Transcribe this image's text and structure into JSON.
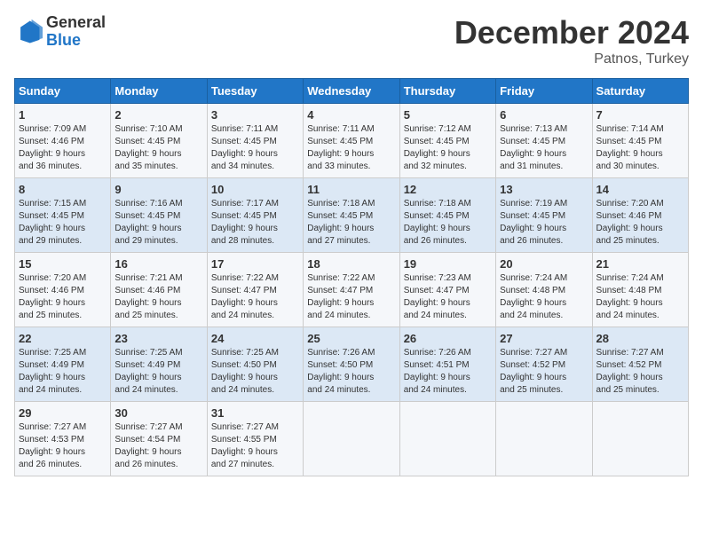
{
  "header": {
    "logo_general": "General",
    "logo_blue": "Blue",
    "month_title": "December 2024",
    "subtitle": "Patnos, Turkey"
  },
  "days_of_week": [
    "Sunday",
    "Monday",
    "Tuesday",
    "Wednesday",
    "Thursday",
    "Friday",
    "Saturday"
  ],
  "weeks": [
    [
      {
        "day": "1",
        "info": "Sunrise: 7:09 AM\nSunset: 4:46 PM\nDaylight: 9 hours\nand 36 minutes."
      },
      {
        "day": "2",
        "info": "Sunrise: 7:10 AM\nSunset: 4:45 PM\nDaylight: 9 hours\nand 35 minutes."
      },
      {
        "day": "3",
        "info": "Sunrise: 7:11 AM\nSunset: 4:45 PM\nDaylight: 9 hours\nand 34 minutes."
      },
      {
        "day": "4",
        "info": "Sunrise: 7:11 AM\nSunset: 4:45 PM\nDaylight: 9 hours\nand 33 minutes."
      },
      {
        "day": "5",
        "info": "Sunrise: 7:12 AM\nSunset: 4:45 PM\nDaylight: 9 hours\nand 32 minutes."
      },
      {
        "day": "6",
        "info": "Sunrise: 7:13 AM\nSunset: 4:45 PM\nDaylight: 9 hours\nand 31 minutes."
      },
      {
        "day": "7",
        "info": "Sunrise: 7:14 AM\nSunset: 4:45 PM\nDaylight: 9 hours\nand 30 minutes."
      }
    ],
    [
      {
        "day": "8",
        "info": "Sunrise: 7:15 AM\nSunset: 4:45 PM\nDaylight: 9 hours\nand 29 minutes."
      },
      {
        "day": "9",
        "info": "Sunrise: 7:16 AM\nSunset: 4:45 PM\nDaylight: 9 hours\nand 29 minutes."
      },
      {
        "day": "10",
        "info": "Sunrise: 7:17 AM\nSunset: 4:45 PM\nDaylight: 9 hours\nand 28 minutes."
      },
      {
        "day": "11",
        "info": "Sunrise: 7:18 AM\nSunset: 4:45 PM\nDaylight: 9 hours\nand 27 minutes."
      },
      {
        "day": "12",
        "info": "Sunrise: 7:18 AM\nSunset: 4:45 PM\nDaylight: 9 hours\nand 26 minutes."
      },
      {
        "day": "13",
        "info": "Sunrise: 7:19 AM\nSunset: 4:45 PM\nDaylight: 9 hours\nand 26 minutes."
      },
      {
        "day": "14",
        "info": "Sunrise: 7:20 AM\nSunset: 4:46 PM\nDaylight: 9 hours\nand 25 minutes."
      }
    ],
    [
      {
        "day": "15",
        "info": "Sunrise: 7:20 AM\nSunset: 4:46 PM\nDaylight: 9 hours\nand 25 minutes."
      },
      {
        "day": "16",
        "info": "Sunrise: 7:21 AM\nSunset: 4:46 PM\nDaylight: 9 hours\nand 25 minutes."
      },
      {
        "day": "17",
        "info": "Sunrise: 7:22 AM\nSunset: 4:47 PM\nDaylight: 9 hours\nand 24 minutes."
      },
      {
        "day": "18",
        "info": "Sunrise: 7:22 AM\nSunset: 4:47 PM\nDaylight: 9 hours\nand 24 minutes."
      },
      {
        "day": "19",
        "info": "Sunrise: 7:23 AM\nSunset: 4:47 PM\nDaylight: 9 hours\nand 24 minutes."
      },
      {
        "day": "20",
        "info": "Sunrise: 7:24 AM\nSunset: 4:48 PM\nDaylight: 9 hours\nand 24 minutes."
      },
      {
        "day": "21",
        "info": "Sunrise: 7:24 AM\nSunset: 4:48 PM\nDaylight: 9 hours\nand 24 minutes."
      }
    ],
    [
      {
        "day": "22",
        "info": "Sunrise: 7:25 AM\nSunset: 4:49 PM\nDaylight: 9 hours\nand 24 minutes."
      },
      {
        "day": "23",
        "info": "Sunrise: 7:25 AM\nSunset: 4:49 PM\nDaylight: 9 hours\nand 24 minutes."
      },
      {
        "day": "24",
        "info": "Sunrise: 7:25 AM\nSunset: 4:50 PM\nDaylight: 9 hours\nand 24 minutes."
      },
      {
        "day": "25",
        "info": "Sunrise: 7:26 AM\nSunset: 4:50 PM\nDaylight: 9 hours\nand 24 minutes."
      },
      {
        "day": "26",
        "info": "Sunrise: 7:26 AM\nSunset: 4:51 PM\nDaylight: 9 hours\nand 24 minutes."
      },
      {
        "day": "27",
        "info": "Sunrise: 7:27 AM\nSunset: 4:52 PM\nDaylight: 9 hours\nand 25 minutes."
      },
      {
        "day": "28",
        "info": "Sunrise: 7:27 AM\nSunset: 4:52 PM\nDaylight: 9 hours\nand 25 minutes."
      }
    ],
    [
      {
        "day": "29",
        "info": "Sunrise: 7:27 AM\nSunset: 4:53 PM\nDaylight: 9 hours\nand 26 minutes."
      },
      {
        "day": "30",
        "info": "Sunrise: 7:27 AM\nSunset: 4:54 PM\nDaylight: 9 hours\nand 26 minutes."
      },
      {
        "day": "31",
        "info": "Sunrise: 7:27 AM\nSunset: 4:55 PM\nDaylight: 9 hours\nand 27 minutes."
      },
      {
        "day": "",
        "info": ""
      },
      {
        "day": "",
        "info": ""
      },
      {
        "day": "",
        "info": ""
      },
      {
        "day": "",
        "info": ""
      }
    ]
  ]
}
